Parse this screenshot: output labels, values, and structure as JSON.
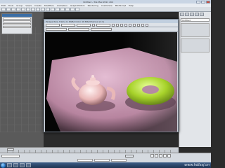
{
  "app": {
    "title": "Untitled - 3ds Max 2011 x64"
  },
  "menu": {
    "items": [
      "Edit",
      "Tools",
      "Group",
      "Views",
      "Create",
      "Modifiers",
      "Animation",
      "Graph Editors",
      "Rendering",
      "Customize",
      "MAXScript",
      "Help"
    ]
  },
  "render_window": {
    "title": "Perspective, frame 0, RGBA Color 16 Bits/Channel (1:1)"
  },
  "right_panel": {
    "name_field": "Untitled"
  },
  "taskbar": {
    "watermark": "www.hdlxsj.cn"
  },
  "colors": {
    "accent": "#3b6ea5",
    "plane": "#d9a8c6",
    "teapot": "#f2c8c8",
    "torus": "#b7e03a"
  },
  "icons": [
    "minimize-icon",
    "maximize-icon",
    "close-icon",
    "start-orb-icon",
    "play-icon"
  ]
}
